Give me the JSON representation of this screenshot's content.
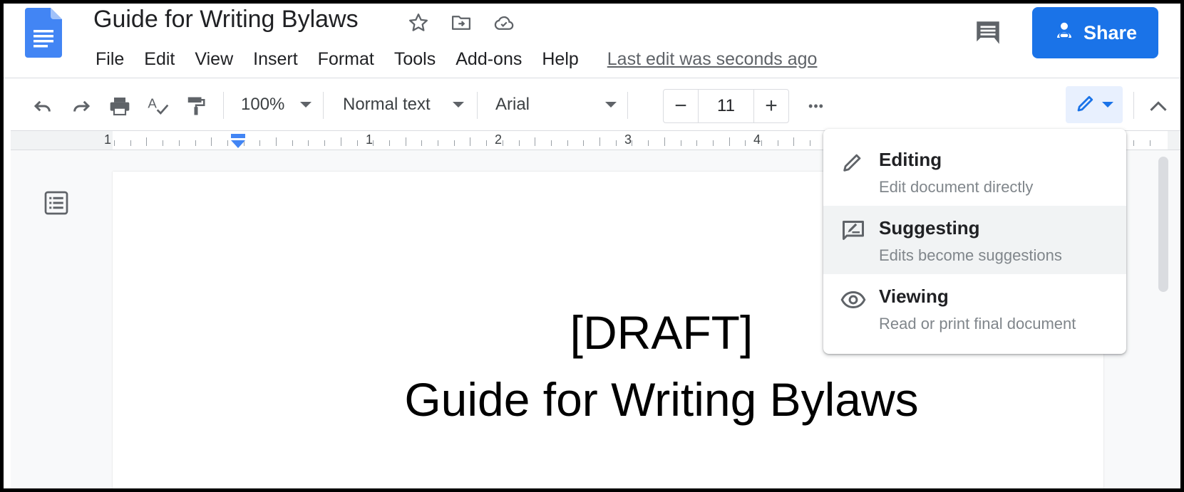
{
  "header": {
    "title": "Guide for Writing Bylaws",
    "menu": [
      "File",
      "Edit",
      "View",
      "Insert",
      "Format",
      "Tools",
      "Add-ons",
      "Help"
    ],
    "last_edit": "Last edit was seconds ago",
    "share_label": "Share"
  },
  "toolbar": {
    "zoom": "100%",
    "style": "Normal text",
    "font": "Arial",
    "font_size": "11",
    "minus": "−",
    "plus": "+",
    "more": "•••"
  },
  "ruler": {
    "numbers": [
      "1",
      "1",
      "2",
      "3",
      "4"
    ]
  },
  "document": {
    "line1": "[DRAFT]",
    "line2": "Guide for Writing Bylaws"
  },
  "mode_menu": {
    "items": [
      {
        "title": "Editing",
        "desc": "Edit document directly",
        "icon": "pencil-icon"
      },
      {
        "title": "Suggesting",
        "desc": "Edits become suggestions",
        "icon": "suggest-icon"
      },
      {
        "title": "Viewing",
        "desc": "Read or print final document",
        "icon": "eye-icon"
      }
    ]
  },
  "colors": {
    "accent": "#1a73e8",
    "docs_blue": "#4285f4"
  }
}
